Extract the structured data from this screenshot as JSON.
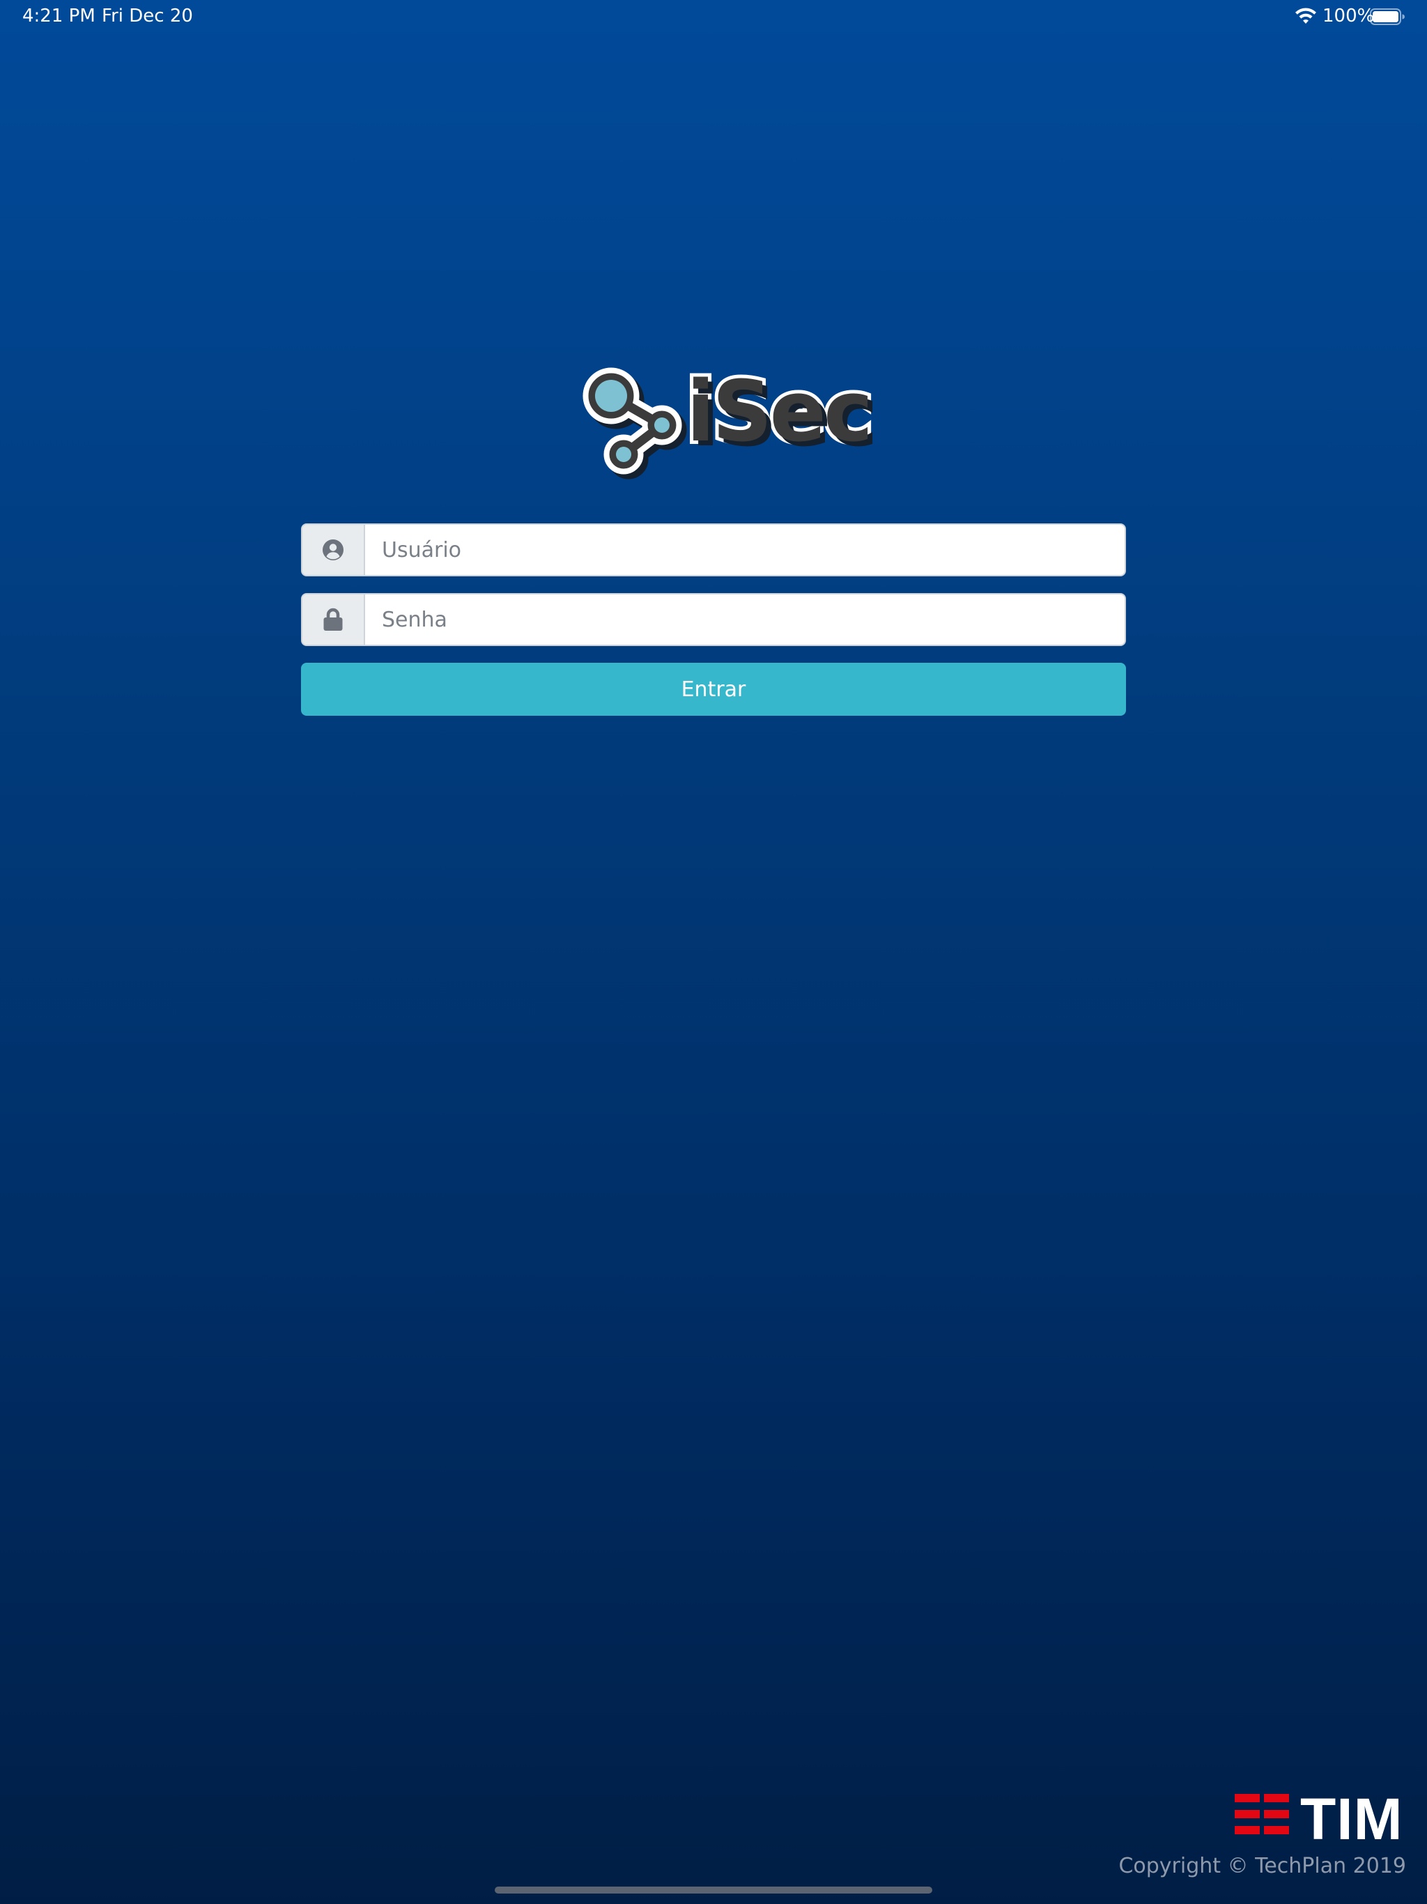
{
  "status_bar": {
    "time": "4:21 PM",
    "date": "Fri Dec 20",
    "battery_percent": "100%",
    "battery_level": 1.0,
    "icons": [
      "wifi-icon",
      "battery-icon"
    ]
  },
  "logo": {
    "text": "iSec",
    "icon": "network-nodes-icon",
    "colors": {
      "node_fill": "#7ec1d3",
      "outline": "#3b3b3b",
      "stroke": "#ffffff"
    }
  },
  "form": {
    "username": {
      "placeholder": "Usuário",
      "value": "",
      "icon": "user-circle-icon"
    },
    "password": {
      "placeholder": "Senha",
      "value": "",
      "icon": "lock-icon"
    },
    "submit_label": "Entrar"
  },
  "footer": {
    "brand": "TIM",
    "brand_icon": "tim-stripes-icon",
    "copyright": "Copyright © TechPlan 2019"
  },
  "colors": {
    "background_top": "#014a9a",
    "background_bottom": "#001e45",
    "button": "#36b7cb",
    "brand_red": "#e30613"
  }
}
